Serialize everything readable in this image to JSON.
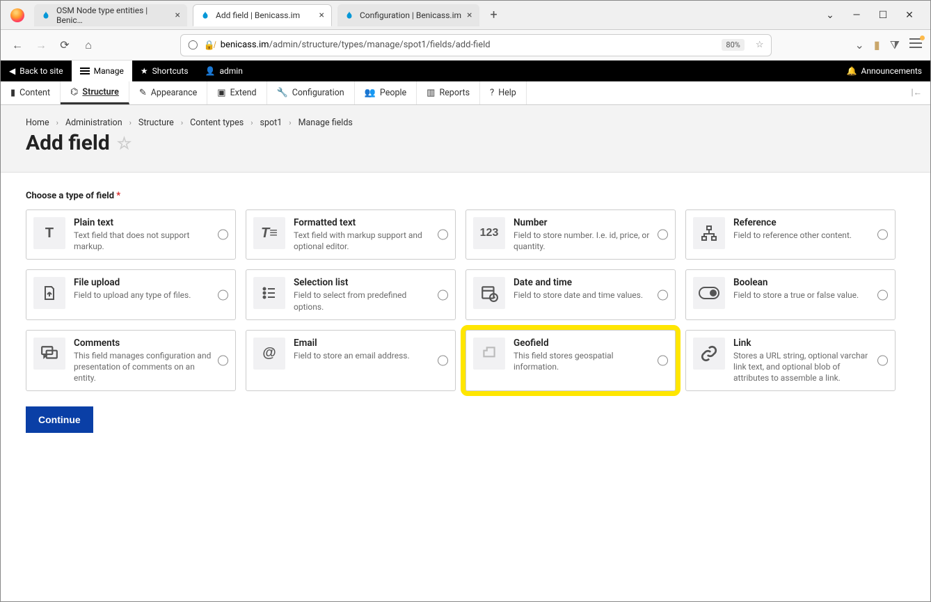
{
  "browser": {
    "tabs": [
      {
        "label": "OSM Node type entities | Benic…"
      },
      {
        "label": "Add field | Benicass.im"
      },
      {
        "label": "Configuration | Benicass.im"
      }
    ],
    "url_domain": "benicass.im",
    "url_path": "/admin/structure/types/manage/spot1/fields/add-field",
    "zoom": "80%"
  },
  "admin_bar": {
    "back": "Back to site",
    "manage": "Manage",
    "shortcuts": "Shortcuts",
    "user": "admin",
    "announcements": "Announcements"
  },
  "menu": {
    "content": "Content",
    "structure": "Structure",
    "appearance": "Appearance",
    "extend": "Extend",
    "configuration": "Configuration",
    "people": "People",
    "reports": "Reports",
    "help": "Help"
  },
  "breadcrumb": [
    "Home",
    "Administration",
    "Structure",
    "Content types",
    "spot1",
    "Manage fields"
  ],
  "page_title": "Add field",
  "legend": "Choose a type of field",
  "fields": [
    {
      "name": "Plain text",
      "desc": "Text field that does not support markup."
    },
    {
      "name": "Formatted text",
      "desc": "Text field with markup support and optional editor."
    },
    {
      "name": "Number",
      "desc": "Field to store number. I.e. id, price, or quantity."
    },
    {
      "name": "Reference",
      "desc": "Field to reference other content."
    },
    {
      "name": "File upload",
      "desc": "Field to upload any type of files."
    },
    {
      "name": "Selection list",
      "desc": "Field to select from predefined options."
    },
    {
      "name": "Date and time",
      "desc": "Field to store date and time values."
    },
    {
      "name": "Boolean",
      "desc": "Field to store a true or false value."
    },
    {
      "name": "Comments",
      "desc": "This field manages configuration and presentation of comments on an entity."
    },
    {
      "name": "Email",
      "desc": "Field to store an email address."
    },
    {
      "name": "Geofield",
      "desc": "This field stores geospatial information."
    },
    {
      "name": "Link",
      "desc": "Stores a URL string, optional varchar link text, and optional blob of attributes to assemble a link."
    }
  ],
  "continue": "Continue"
}
